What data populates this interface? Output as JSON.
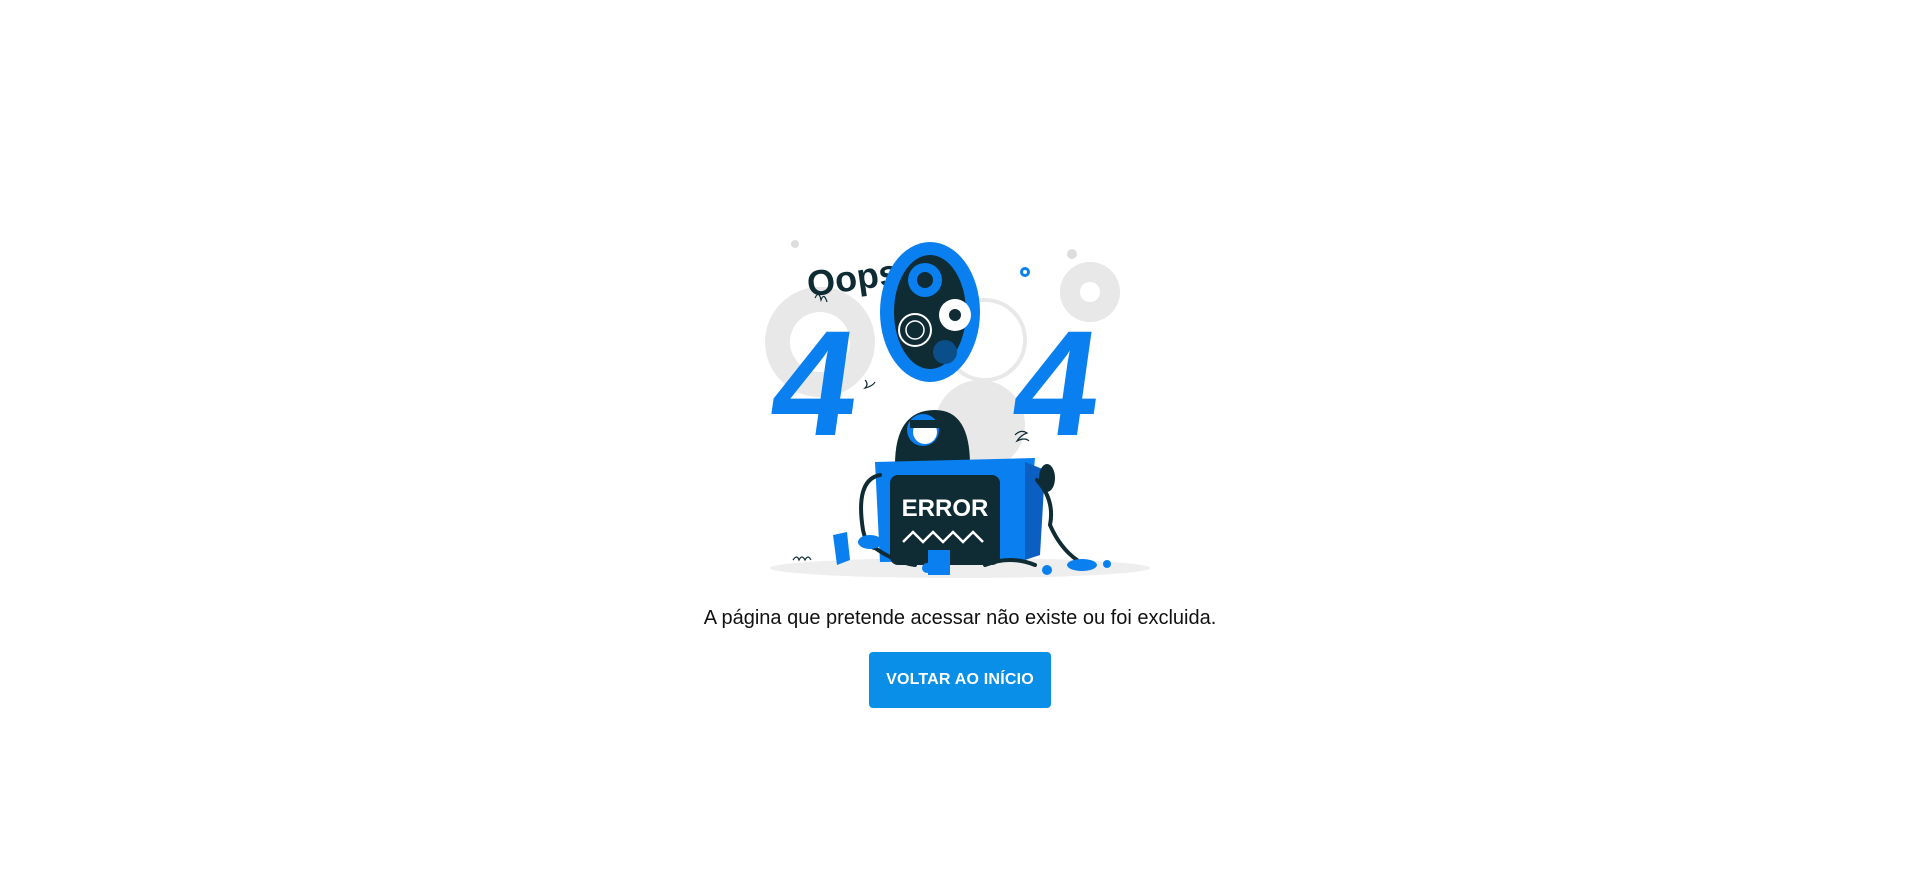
{
  "illustration": {
    "oops_text": "Oops!",
    "digit_left": "4",
    "digit_right": "4",
    "screen_text": "ERROR",
    "colors": {
      "blue": "#0a7ff0",
      "dark": "#0f2b33",
      "gear_gray": "#e6e6e6"
    }
  },
  "message": "A página que pretende acessar não existe ou foi excluida.",
  "button": {
    "label": "VOLTAR AO INÍCIO",
    "color": "#0a8fe8"
  }
}
